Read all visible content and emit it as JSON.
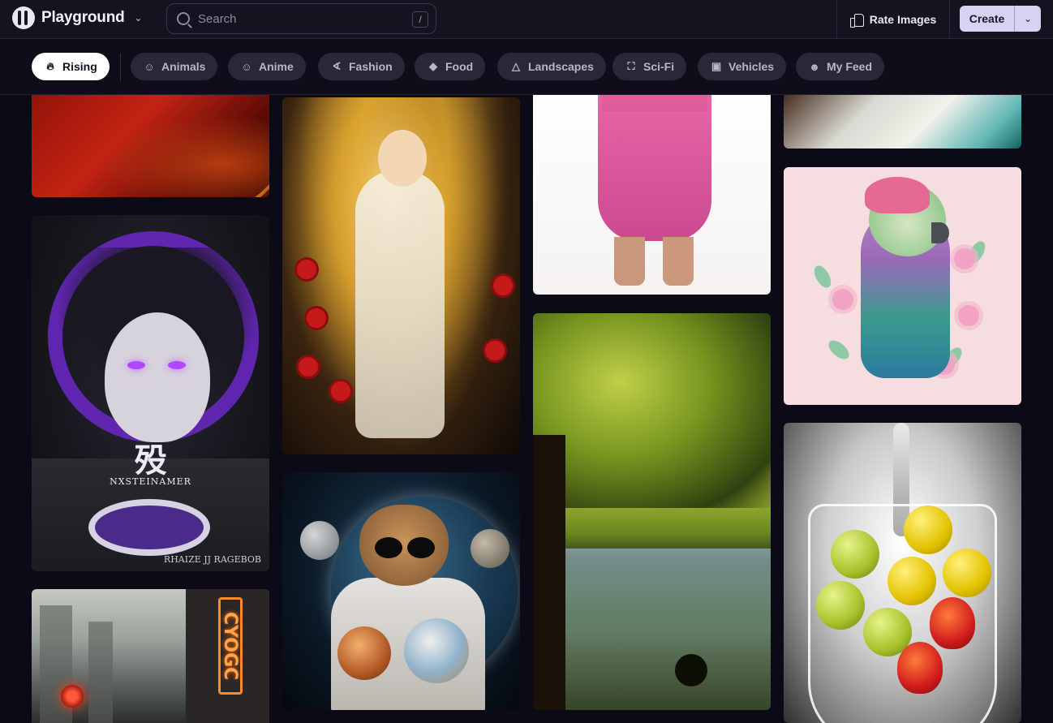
{
  "app": {
    "name": "Playground"
  },
  "header": {
    "search_placeholder": "Search",
    "search_shortcut": "/",
    "rate_label": "Rate Images",
    "create_label": "Create"
  },
  "categories": [
    {
      "label": "Rising",
      "icon": "flame-icon",
      "active": true
    },
    {
      "label": "Animals",
      "icon": "cat-face-icon",
      "active": false
    },
    {
      "label": "Anime",
      "icon": "smile-icon",
      "active": false
    },
    {
      "label": "Fashion",
      "icon": "shoe-icon",
      "active": false
    },
    {
      "label": "Food",
      "icon": "food-icon",
      "active": false
    },
    {
      "label": "Landscapes",
      "icon": "mountain-icon",
      "active": false
    },
    {
      "label": "Sci-Fi",
      "icon": "robot-icon",
      "active": false
    },
    {
      "label": "Vehicles",
      "icon": "car-icon",
      "active": false
    },
    {
      "label": "My Feed",
      "icon": "user-icon",
      "active": false
    }
  ],
  "images": [
    {
      "subject": "abstract red and orange swirl"
    },
    {
      "subject": "golden-haired anime woman with red roses"
    },
    {
      "subject": "pink slip dress back view"
    },
    {
      "subject": "white and teal embroidered gown"
    },
    {
      "subject": "anime girl with purple glowing eyes",
      "caption_large": "殁",
      "caption_small": "NXSTEINAMER",
      "caption_corner": "RHAIZE JJ RAGEBOB"
    },
    {
      "subject": "cat astronaut with sunglasses holding planets"
    },
    {
      "subject": "green trees over a lake"
    },
    {
      "subject": "watercolor parrot with pink flowers"
    },
    {
      "subject": "apples and strawberries in a glass with water"
    },
    {
      "subject": "foggy cyberpunk street with neon sign",
      "sign_text": "CYOGC"
    }
  ],
  "colors": {
    "background": "#0c0a16",
    "header": "#15131f",
    "chip": "#2a2836",
    "chip_active": "#ffffff",
    "create_button": "#d8d2f2"
  }
}
